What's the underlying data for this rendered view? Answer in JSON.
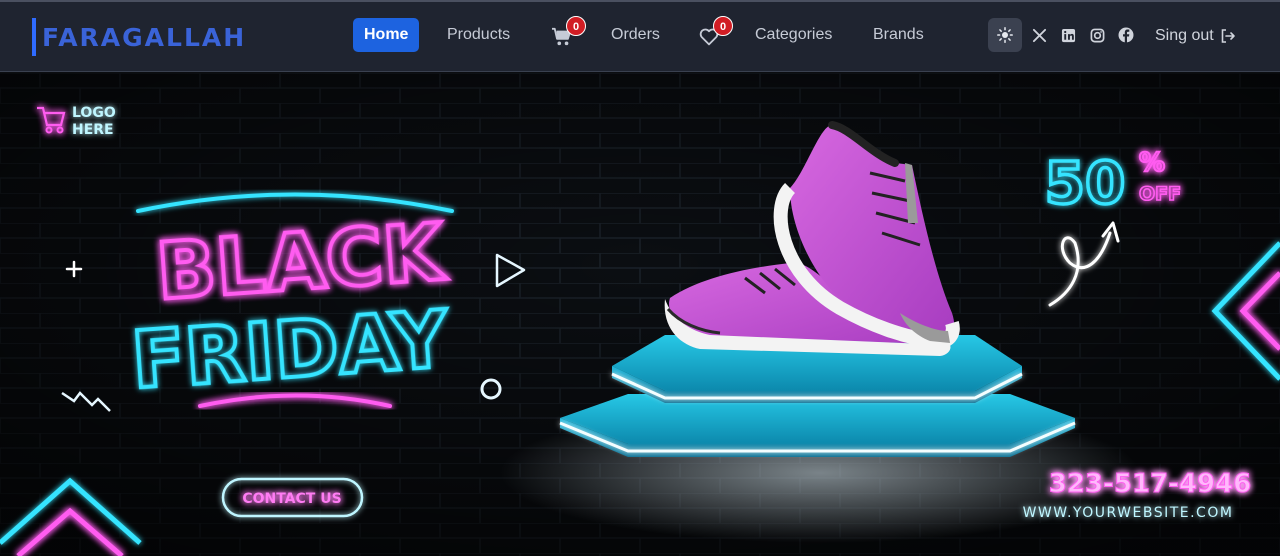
{
  "brand": {
    "name": "FARAGALLAH"
  },
  "nav": {
    "items": [
      {
        "label": "Home",
        "active": true
      },
      {
        "label": "Products"
      },
      {
        "label": "Orders"
      },
      {
        "label": "Categories"
      },
      {
        "label": "Brands"
      }
    ],
    "cart_count": "0",
    "wishlist_count": "0"
  },
  "social": [
    "x-icon",
    "linkedin-icon",
    "instagram-icon",
    "facebook-icon"
  ],
  "signout_label": "Sing out",
  "colors": {
    "accent": "#1d63e0",
    "navbar_bg": "#1f2430",
    "badge": "#d11d24",
    "neon_pink": "#ff5cf0",
    "neon_cyan": "#34e4ff"
  },
  "banner": {
    "logo_line1": "LOGO",
    "logo_line2": "HERE",
    "title_line1": "BLACK",
    "title_line2": "FRIDAY",
    "discount_number": "50",
    "discount_percent": "%",
    "discount_off": "OFF",
    "contact_label": "CONTACT US",
    "phone": "323-517-4946",
    "website": "WWW.YOURWEBSITE.COM"
  }
}
